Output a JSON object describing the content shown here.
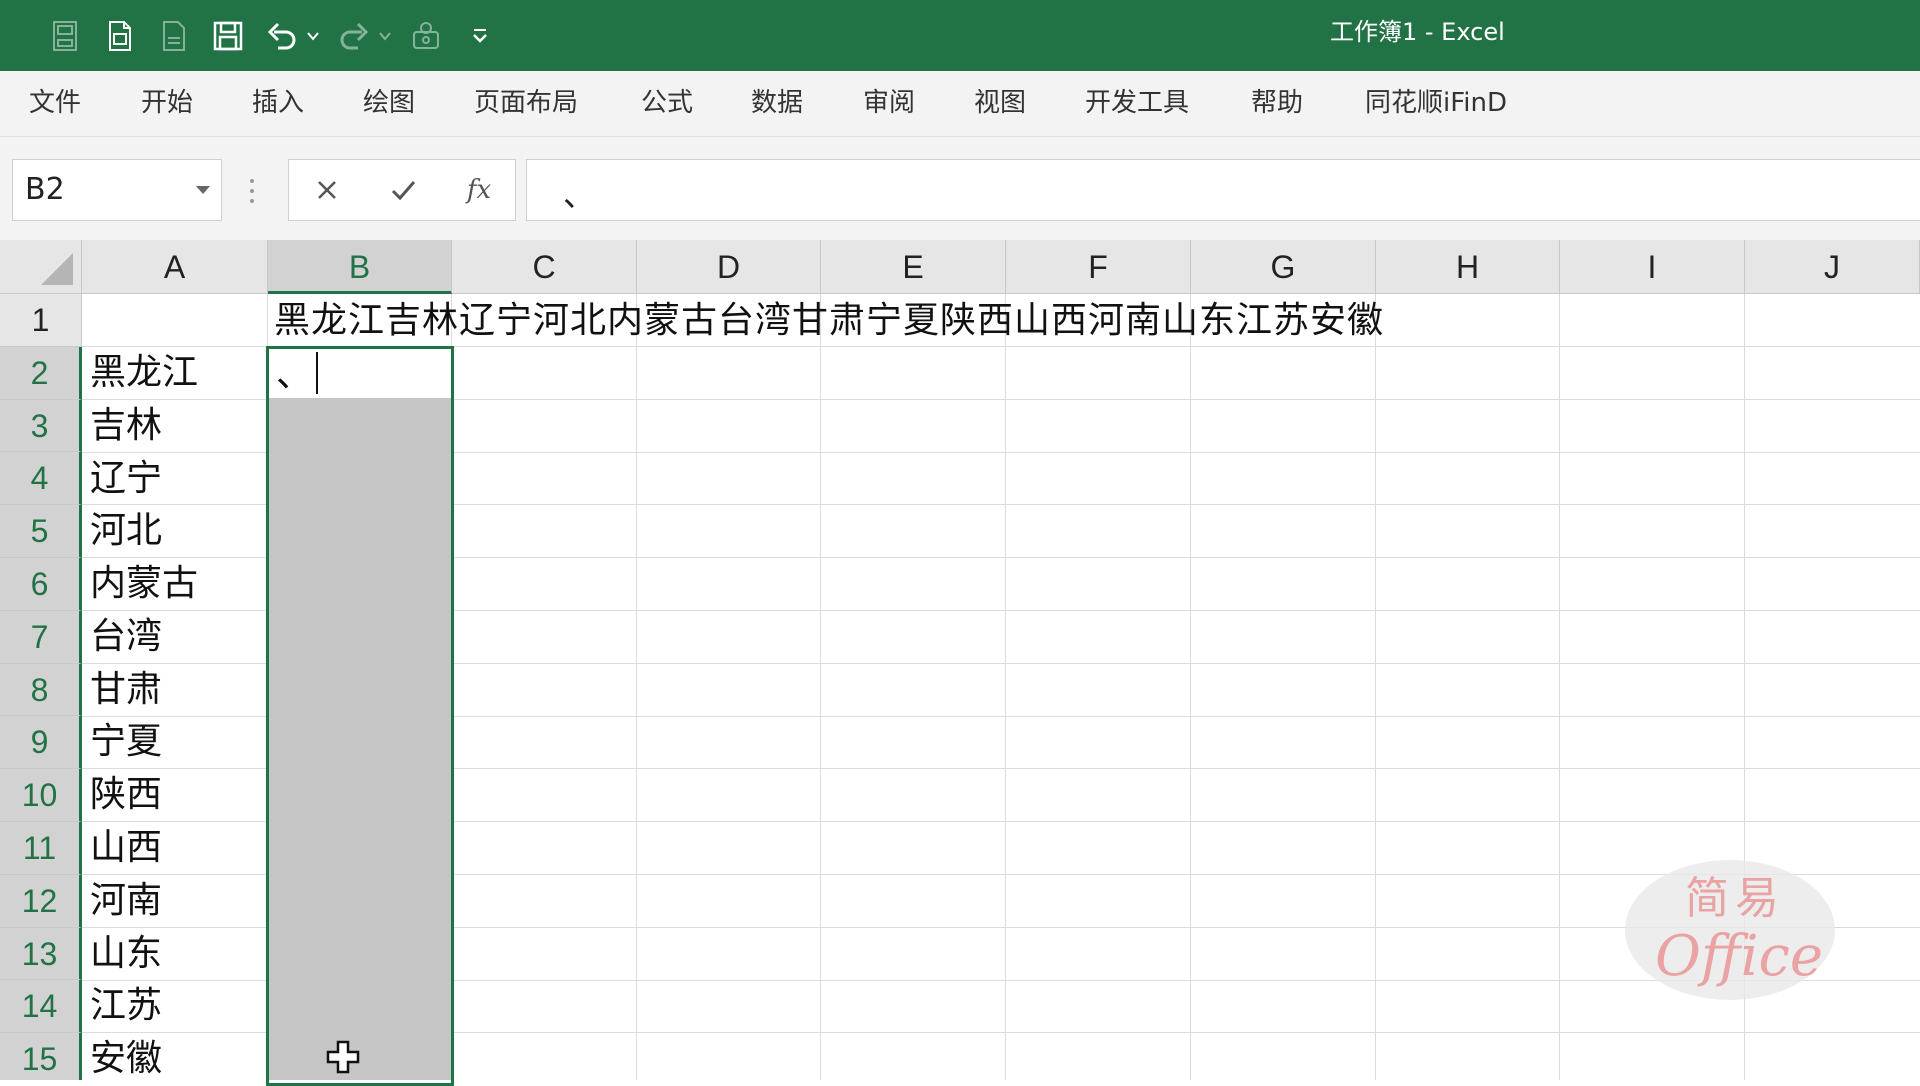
{
  "window": {
    "title": "工作簿1  -  Excel"
  },
  "colors": {
    "brand": "#217346",
    "selection_fill": "#c6c6c6",
    "watermark": "#e9a3a3"
  },
  "quick_access": [
    "autosave-icon",
    "new-file-icon",
    "open-file-icon",
    "save-icon",
    "undo-icon",
    "redo-icon",
    "macro-icon",
    "customize-qat-icon"
  ],
  "ribbon": {
    "tabs": [
      "文件",
      "开始",
      "插入",
      "绘图",
      "页面布局",
      "公式",
      "数据",
      "审阅",
      "视图",
      "开发工具",
      "帮助",
      "同花顺iFinD"
    ]
  },
  "formula_bar": {
    "name_box": "B2",
    "fx_label": "fx",
    "value": "、"
  },
  "sheet": {
    "columns": [
      "A",
      "B",
      "C",
      "D",
      "E",
      "F",
      "G",
      "H",
      "I",
      "J"
    ],
    "selected_column": "B",
    "rows": [
      "1",
      "2",
      "3",
      "4",
      "5",
      "6",
      "7",
      "8",
      "9",
      "10",
      "11",
      "12",
      "13",
      "14",
      "15"
    ],
    "selected_rows": [
      "2",
      "3",
      "4",
      "5",
      "6",
      "7",
      "8",
      "9",
      "10",
      "11",
      "12",
      "13",
      "14",
      "15"
    ],
    "b1_value": "黑龙江吉林辽宁河北内蒙古台湾甘肃宁夏陕西山西河南山东江苏安徽",
    "b2_value": "、",
    "column_a": [
      "黑龙江",
      "吉林",
      "辽宁",
      "河北",
      "内蒙古",
      "台湾",
      "甘肃",
      "宁夏",
      "陕西",
      "山西",
      "河南",
      "山东",
      "江苏",
      "安徽"
    ]
  },
  "watermark": {
    "top": "简易",
    "bottom": "Office"
  }
}
